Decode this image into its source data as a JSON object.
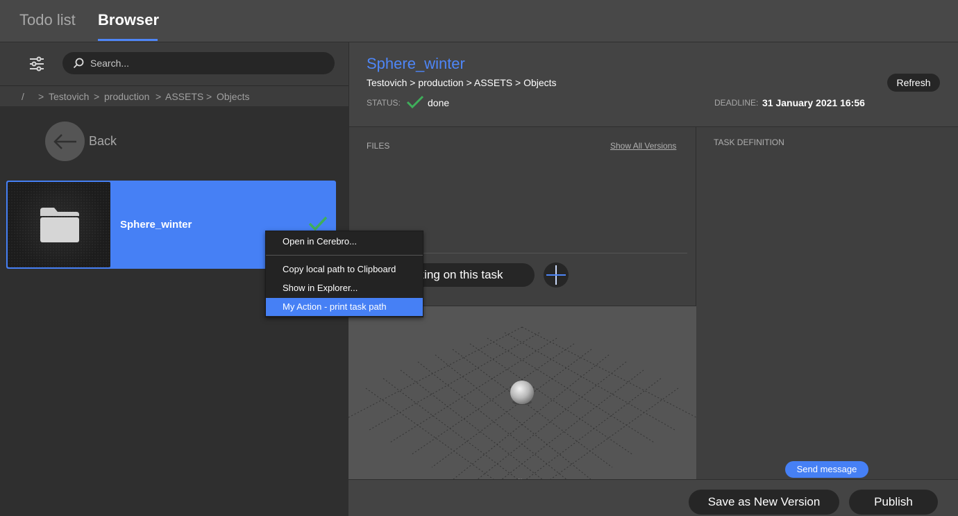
{
  "tabs": [
    {
      "label": "Todo list",
      "active": false
    },
    {
      "label": "Browser",
      "active": true
    }
  ],
  "accent_color": "#4e86f7",
  "status_color": "#3fae5a",
  "search": {
    "placeholder": "Search..."
  },
  "breadcrumb": [
    "/",
    ">",
    "Testovich",
    ">",
    "production",
    ">",
    "ASSETS",
    ">",
    "Objects"
  ],
  "back_label": "Back",
  "item": {
    "title": "Sphere_winter",
    "icon": "folder-icon",
    "status_icon": "checkmark-icon"
  },
  "context_menu": {
    "items": [
      "Open in Cerebro...",
      "Copy local path to Clipboard",
      "Show in Explorer...",
      "My Action - print task path"
    ],
    "highlighted": "My Action - print task path"
  },
  "task": {
    "title": "Sphere_winter",
    "path": "Testovich > production > ASSETS > Objects",
    "refresh_label": "Refresh",
    "status_label": "STATUS:",
    "status_value": "done",
    "deadline_label": "DEADLINE:",
    "deadline_value": "31 January 2021 16:56"
  },
  "files": {
    "label": "FILES",
    "show_all_label": "Show All Versions",
    "working_label": "rking on this task"
  },
  "task_definition": {
    "label": "TASK DEFINITION",
    "send_label": "Send message"
  },
  "footer": {
    "save_label": "Save as New Version",
    "publish_label": "Publish"
  }
}
